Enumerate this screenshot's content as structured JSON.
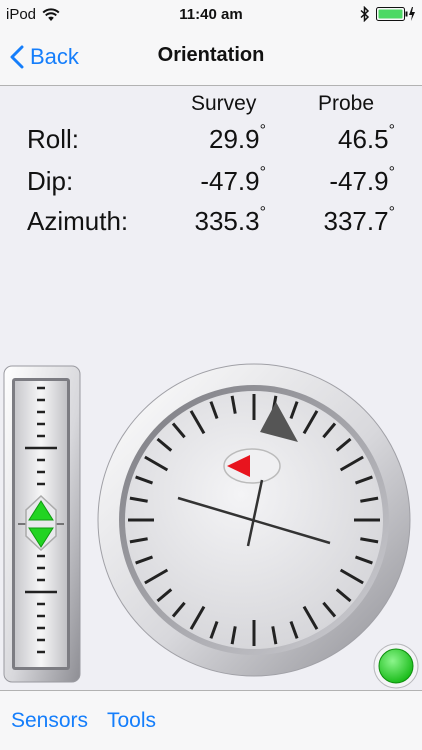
{
  "status_bar": {
    "carrier": "iPod",
    "time": "11:40 am"
  },
  "nav": {
    "back_label": "Back",
    "title": "Orientation"
  },
  "readings": {
    "columns": [
      "Survey",
      "Probe"
    ],
    "rows": [
      {
        "label": "Roll:",
        "survey": "29.9",
        "probe": "46.5"
      },
      {
        "label": "Dip:",
        "survey": "-47.9",
        "probe": "-47.9"
      },
      {
        "label": "Azimuth:",
        "survey": "335.3",
        "probe": "337.7"
      }
    ],
    "degree_symbol": "°"
  },
  "indicators": {
    "status_light_color": "#1ec81e",
    "pointer_red": "#e8141e",
    "pointer_green": "#22d422",
    "reference_marker": "#555555"
  },
  "tab_bar": {
    "items": [
      "Sensors",
      "Tools"
    ]
  },
  "colors": {
    "accent": "#157efb",
    "background": "#efeff4"
  }
}
